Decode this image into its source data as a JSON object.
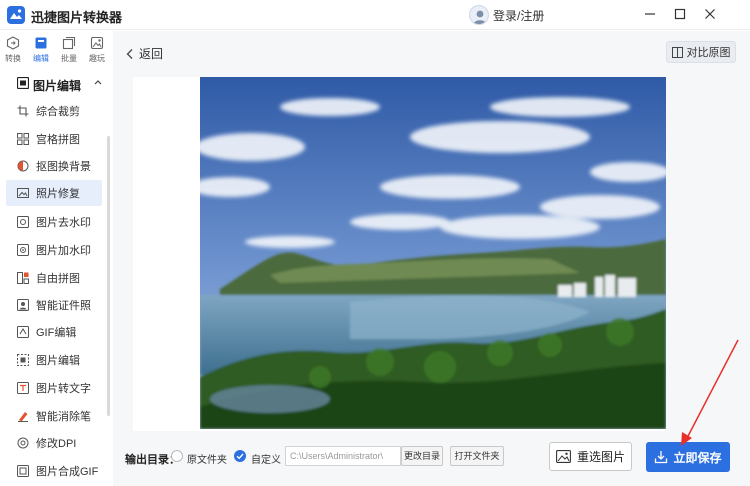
{
  "app": {
    "title": "迅捷图片转换器",
    "brand_color": "#2b6fe0"
  },
  "user": {
    "label": "登录/注册"
  },
  "window_controls": [
    "minimize-icon",
    "restore-icon",
    "close-icon"
  ],
  "nav_tabs": [
    {
      "label": "转换",
      "icon": "convert-icon",
      "active": false
    },
    {
      "label": "编辑",
      "icon": "edit-icon",
      "active": true
    },
    {
      "label": "批量",
      "icon": "batch-icon",
      "active": false
    },
    {
      "label": "趣玩",
      "icon": "fun-icon",
      "active": false
    }
  ],
  "sidebar": {
    "section_title": "图片编辑",
    "items": [
      {
        "label": "综合裁剪",
        "icon": "crop-icon"
      },
      {
        "label": "宫格拼图",
        "icon": "grid-icon"
      },
      {
        "label": "抠图换背景",
        "icon": "cutout-icon"
      },
      {
        "label": "照片修复",
        "icon": "repair-icon",
        "active": true
      },
      {
        "label": "图片去水印",
        "icon": "remove-watermark-icon"
      },
      {
        "label": "图片加水印",
        "icon": "add-watermark-icon"
      },
      {
        "label": "自由拼图",
        "icon": "collage-icon"
      },
      {
        "label": "智能证件照",
        "icon": "id-photo-icon"
      },
      {
        "label": "GIF编辑",
        "icon": "gif-icon"
      },
      {
        "label": "图片编辑",
        "icon": "image-edit-icon"
      },
      {
        "label": "图片转文字",
        "icon": "ocr-icon"
      },
      {
        "label": "智能消除笔",
        "icon": "eraser-icon"
      },
      {
        "label": "修改DPI",
        "icon": "dpi-icon"
      },
      {
        "label": "图片合成GIF",
        "icon": "gif-compose-icon"
      }
    ]
  },
  "main": {
    "back_label": "返回",
    "compare_label": "对比原图"
  },
  "bottom": {
    "output_label": "输出目录：",
    "option_original": "原文件夹",
    "option_custom": "自定义",
    "path_value": "C:\\Users\\Administrator\\",
    "change_dir": "更改目录",
    "open_folder": "打开文件夹",
    "reselect": "重选图片",
    "save": "立即保存"
  }
}
